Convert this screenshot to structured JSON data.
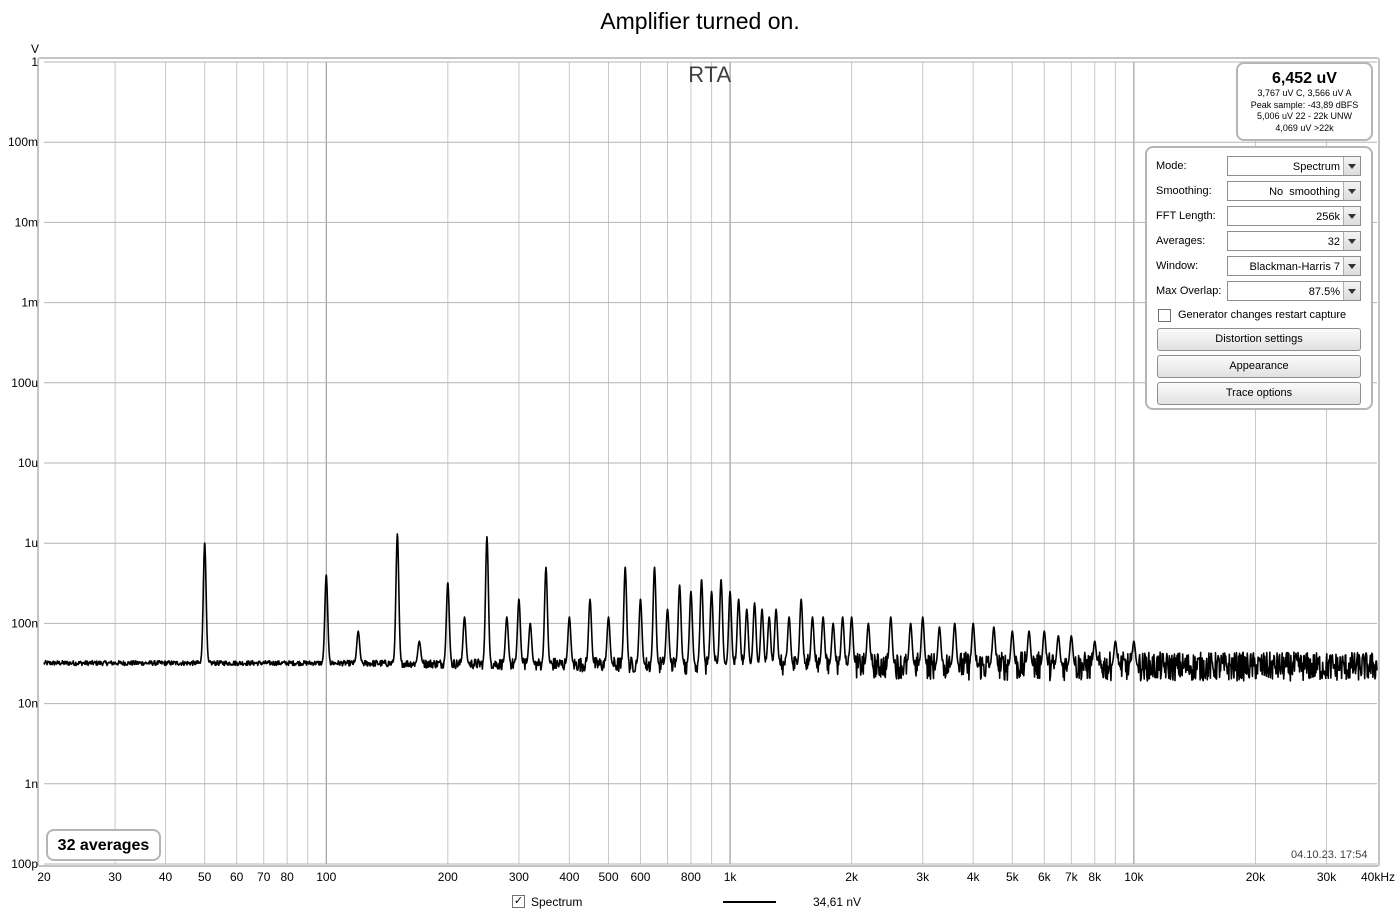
{
  "chart_data": {
    "type": "line",
    "title": "Amplifier turned on.",
    "panel_title": "RTA",
    "y_unit": "V",
    "x_unit": "kHz",
    "x_scale": "log",
    "y_scale": "log",
    "xlim": [
      20,
      40000
    ],
    "ylim": [
      1e-10,
      1
    ],
    "grid": true,
    "x_ticks": [
      {
        "value": 20,
        "label": "20"
      },
      {
        "value": 30,
        "label": "30"
      },
      {
        "value": 40,
        "label": "40"
      },
      {
        "value": 50,
        "label": "50"
      },
      {
        "value": 60,
        "label": "60"
      },
      {
        "value": 70,
        "label": "70"
      },
      {
        "value": 80,
        "label": "80"
      },
      {
        "value": 100,
        "label": "100"
      },
      {
        "value": 200,
        "label": "200"
      },
      {
        "value": 300,
        "label": "300"
      },
      {
        "value": 400,
        "label": "400"
      },
      {
        "value": 500,
        "label": "500"
      },
      {
        "value": 600,
        "label": "600"
      },
      {
        "value": 800,
        "label": "800"
      },
      {
        "value": 1000,
        "label": "1k"
      },
      {
        "value": 2000,
        "label": "2k"
      },
      {
        "value": 3000,
        "label": "3k"
      },
      {
        "value": 4000,
        "label": "4k"
      },
      {
        "value": 5000,
        "label": "5k"
      },
      {
        "value": 6000,
        "label": "6k"
      },
      {
        "value": 7000,
        "label": "7k"
      },
      {
        "value": 8000,
        "label": "8k"
      },
      {
        "value": 10000,
        "label": "10k"
      },
      {
        "value": 20000,
        "label": "20k"
      },
      {
        "value": 30000,
        "label": "30k"
      },
      {
        "value": 40000,
        "label": "40kHz"
      }
    ],
    "y_ticks": [
      {
        "value": 1,
        "label": "1"
      },
      {
        "value": 0.1,
        "label": "100m"
      },
      {
        "value": 0.01,
        "label": "10m"
      },
      {
        "value": 0.001,
        "label": "1m"
      },
      {
        "value": 0.0001,
        "label": "100u"
      },
      {
        "value": 1e-05,
        "label": "10u"
      },
      {
        "value": 1e-06,
        "label": "1u"
      },
      {
        "value": 1e-07,
        "label": "100n"
      },
      {
        "value": 1e-08,
        "label": "10n"
      },
      {
        "value": 1e-09,
        "label": "1n"
      },
      {
        "value": 1e-10,
        "label": "100p"
      }
    ],
    "series": [
      {
        "name": "Spectrum",
        "color": "#000000",
        "noise_floor": [
          [
            20,
            3.2e-08
          ],
          [
            100,
            3.2e-08
          ],
          [
            1000,
            3e-08
          ],
          [
            10000,
            2.9e-08
          ],
          [
            40000,
            2.9e-08
          ]
        ],
        "peaks": [
          [
            50,
            1e-06
          ],
          [
            100,
            4e-07
          ],
          [
            120,
            8e-08
          ],
          [
            150,
            1.3e-06
          ],
          [
            170,
            6e-08
          ],
          [
            200,
            3.2e-07
          ],
          [
            220,
            1.2e-07
          ],
          [
            250,
            1.2e-06
          ],
          [
            280,
            1.2e-07
          ],
          [
            300,
            2e-07
          ],
          [
            320,
            1e-07
          ],
          [
            350,
            5e-07
          ],
          [
            400,
            1.2e-07
          ],
          [
            450,
            2e-07
          ],
          [
            500,
            1.2e-07
          ],
          [
            550,
            5e-07
          ],
          [
            600,
            2e-07
          ],
          [
            650,
            5e-07
          ],
          [
            700,
            1.5e-07
          ],
          [
            750,
            3e-07
          ],
          [
            800,
            2.5e-07
          ],
          [
            850,
            3.5e-07
          ],
          [
            900,
            2.5e-07
          ],
          [
            950,
            3.5e-07
          ],
          [
            1000,
            2.5e-07
          ],
          [
            1050,
            2e-07
          ],
          [
            1100,
            1.5e-07
          ],
          [
            1150,
            1.8e-07
          ],
          [
            1200,
            1.5e-07
          ],
          [
            1250,
            1.2e-07
          ],
          [
            1300,
            1.5e-07
          ],
          [
            1400,
            1.2e-07
          ],
          [
            1500,
            2e-07
          ],
          [
            1600,
            1.2e-07
          ],
          [
            1700,
            1.2e-07
          ],
          [
            1800,
            1e-07
          ],
          [
            1900,
            1.2e-07
          ],
          [
            2000,
            1.2e-07
          ],
          [
            2200,
            1e-07
          ],
          [
            2500,
            1.2e-07
          ],
          [
            2800,
            1e-07
          ],
          [
            3000,
            1.2e-07
          ],
          [
            3300,
            9e-08
          ],
          [
            3600,
            1e-07
          ],
          [
            4000,
            1e-07
          ],
          [
            4500,
            9e-08
          ],
          [
            5000,
            8e-08
          ],
          [
            5500,
            8e-08
          ],
          [
            6000,
            8e-08
          ],
          [
            6500,
            7e-08
          ],
          [
            7000,
            7e-08
          ],
          [
            8000,
            6e-08
          ],
          [
            9000,
            6e-08
          ],
          [
            10000,
            6e-08
          ]
        ]
      }
    ],
    "legend": {
      "label": "Spectrum",
      "checked": true,
      "value": "34,61 nV",
      "placement": "bottom-center"
    }
  },
  "level_box": {
    "main": "6,452 uV",
    "lines": [
      "3,767 uV C, 3,566 uV A",
      "Peak sample: -43,89 dBFS",
      "5,006 uV 22 - 22k UNW",
      "4,069 uV >22k"
    ]
  },
  "controls": {
    "rows": [
      {
        "label": "Mode:",
        "value": "Spectrum"
      },
      {
        "label": "Smoothing:",
        "value": "No  smoothing"
      },
      {
        "label": "FFT Length:",
        "value": "256k"
      },
      {
        "label": "Averages:",
        "value": "32"
      },
      {
        "label": "Window:",
        "value": "Blackman-Harris 7"
      },
      {
        "label": "Max Overlap:",
        "value": "87.5%"
      }
    ],
    "generator_checkbox_label": "Generator changes restart capture",
    "generator_checked": false,
    "buttons": [
      "Distortion settings",
      "Appearance",
      "Trace options"
    ]
  },
  "averages_badge": "32 averages",
  "timestamp": "04.10.23. 17:54"
}
